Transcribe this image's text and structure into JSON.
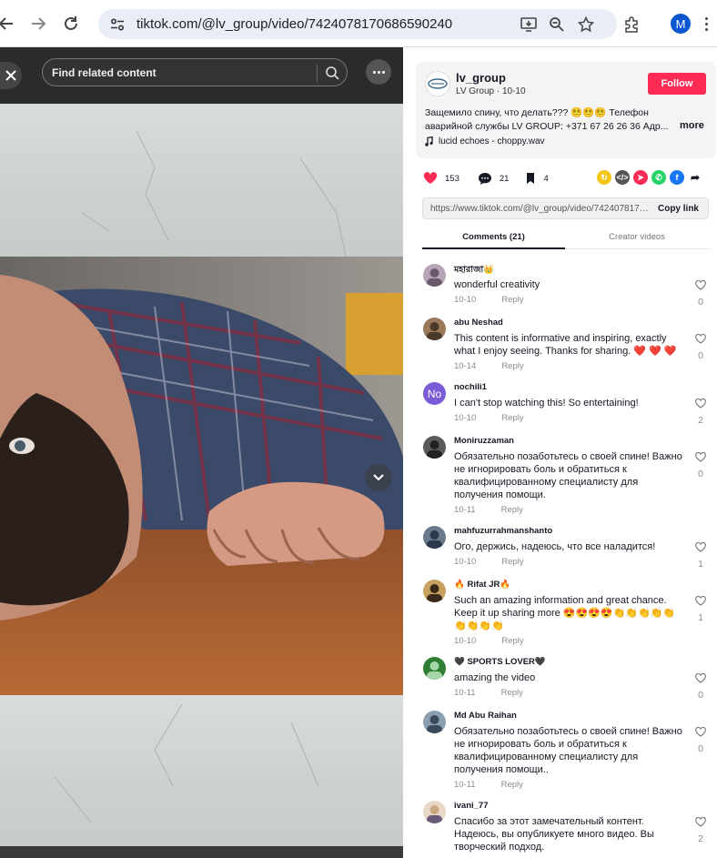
{
  "browser": {
    "url": "tiktok.com/@lv_group/video/7424078170686590240",
    "profile_initial": "M"
  },
  "video": {
    "search_placeholder": "Find related content"
  },
  "author": {
    "username": "lv_group",
    "subtitle": "LV Group · 10-10",
    "follow_label": "Follow",
    "description": "Защемило спину, что делать??? 😵‍💫😵‍💫😵‍💫 Телефон аварийной службы LV GROUP: +371 67 26 26 36 Адр...",
    "more_label": "more",
    "music": "lucid echoes - choppy.wav"
  },
  "stats": {
    "likes": "153",
    "comments": "21",
    "saves": "4"
  },
  "share_link": {
    "url": "https://www.tiktok.com/@lv_group/video/7424078170...",
    "copy_label": "Copy link"
  },
  "tabs": {
    "comments": "Comments (21)",
    "creator": "Creator videos"
  },
  "reply_label": "Reply",
  "comments": [
    {
      "name": "মহারাজা👑",
      "text": "wonderful creativity",
      "date": "10-10",
      "likes": "0"
    },
    {
      "name": "abu Neshad",
      "text": "This content is informative and inspiring, exactly what I enjoy seeing. Thanks for sharing. ❤️ ❤️ ❤️",
      "date": "10-14",
      "likes": "0"
    },
    {
      "name": "nochili1",
      "text": "I can't stop watching this! So entertaining!",
      "date": "10-10",
      "likes": "2",
      "avatar_text": "No"
    },
    {
      "name": "Moniruzzaman",
      "text": "Обязательно позаботьтесь о своей спине! Важно не игнорировать боль и обратиться к квалифицированному специалисту для получения помощи.",
      "date": "10-11",
      "likes": "0"
    },
    {
      "name": "mahfuzurrahmanshanto",
      "text": "Ого, держись, надеюсь, что все наладится!",
      "date": "10-10",
      "likes": "1"
    },
    {
      "name": "🔥 Rifat JR🔥",
      "text": "Such an amazing information and great chance. Keep it up sharing more 😍😍😍😍👏👏👏👏👏👏👏👏👏",
      "date": "10-10",
      "likes": "1"
    },
    {
      "name": "🖤 SPORTS LOVER🖤",
      "text": "amazing the video",
      "date": "10-11",
      "likes": "0"
    },
    {
      "name": "Md Abu Raihan",
      "text": "Обязательно позаботьтесь о своей спине! Важно не игнорировать боль и обратиться к квалифицированному специалисту для получения помощи..",
      "date": "10-11",
      "likes": "0"
    },
    {
      "name": "ivani_77",
      "text": "Спасибо за этот замечательный контент. Надеюсь, вы опубликуете много видео. Вы творческий подход.",
      "date": "",
      "likes": "2"
    }
  ],
  "colors": {
    "follow": "#fe2c55",
    "like_heart": "#fe2c55",
    "avatar_nochili": "#7b5bd6"
  }
}
